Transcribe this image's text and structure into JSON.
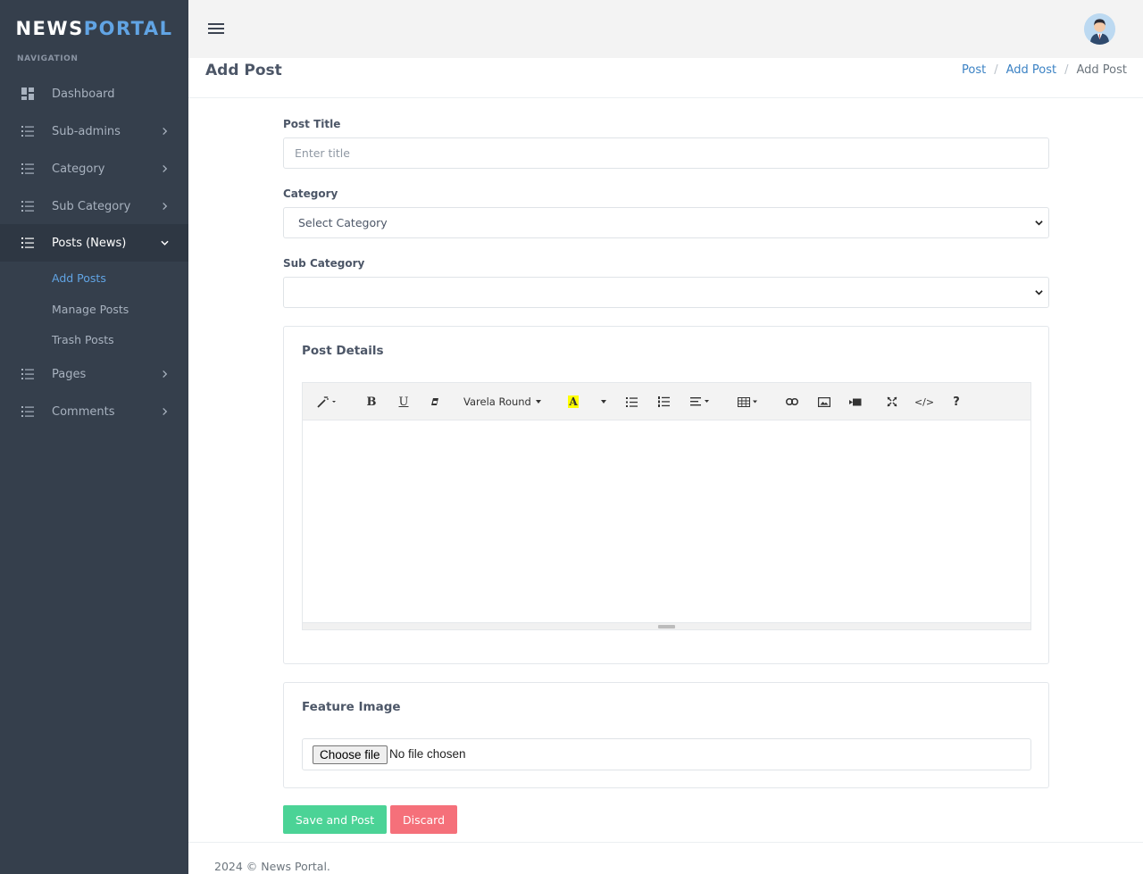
{
  "sidebar": {
    "brand_part1": "NEWS",
    "brand_part2": "PORTAL",
    "nav_heading": "NAVIGATION",
    "items": [
      {
        "label": "Dashboard",
        "icon": "dashboard-icon"
      },
      {
        "label": "Sub-admins",
        "icon": "list-icon"
      },
      {
        "label": "Category",
        "icon": "list-icon"
      },
      {
        "label": "Sub Category",
        "icon": "list-icon"
      },
      {
        "label": "Posts (News)",
        "icon": "list-icon",
        "expanded": true
      },
      {
        "label": "Pages",
        "icon": "list-icon"
      },
      {
        "label": "Comments",
        "icon": "list-icon"
      }
    ],
    "posts_submenu": [
      "Add Posts",
      "Manage Posts",
      "Trash Posts"
    ]
  },
  "topbar": {
    "menu_icon": "hamburger-icon",
    "avatar_icon": "user-avatar-icon"
  },
  "page": {
    "title": "Add Post",
    "breadcrumb": [
      "Post",
      "Add Post",
      "Add Post"
    ]
  },
  "form": {
    "post_title_label": "Post Title",
    "post_title_placeholder": "Enter title",
    "category_label": "Category",
    "category_selected": "Select Category",
    "subcategory_label": "Sub Category",
    "subcategory_selected": "",
    "details_title": "Post Details",
    "toolbar_font": "Varela Round",
    "feature_image_title": "Feature Image",
    "file_button": "Choose file",
    "file_status": "No file chosen",
    "save_label": "Save and Post",
    "discard_label": "Discard"
  },
  "colors": {
    "sidebar_bg": "#353f4c",
    "accent_blue": "#61a4e4",
    "save_green": "#4bd396",
    "discard_red": "#f5707a"
  },
  "footer": {
    "text": "2024 © News Portal."
  }
}
